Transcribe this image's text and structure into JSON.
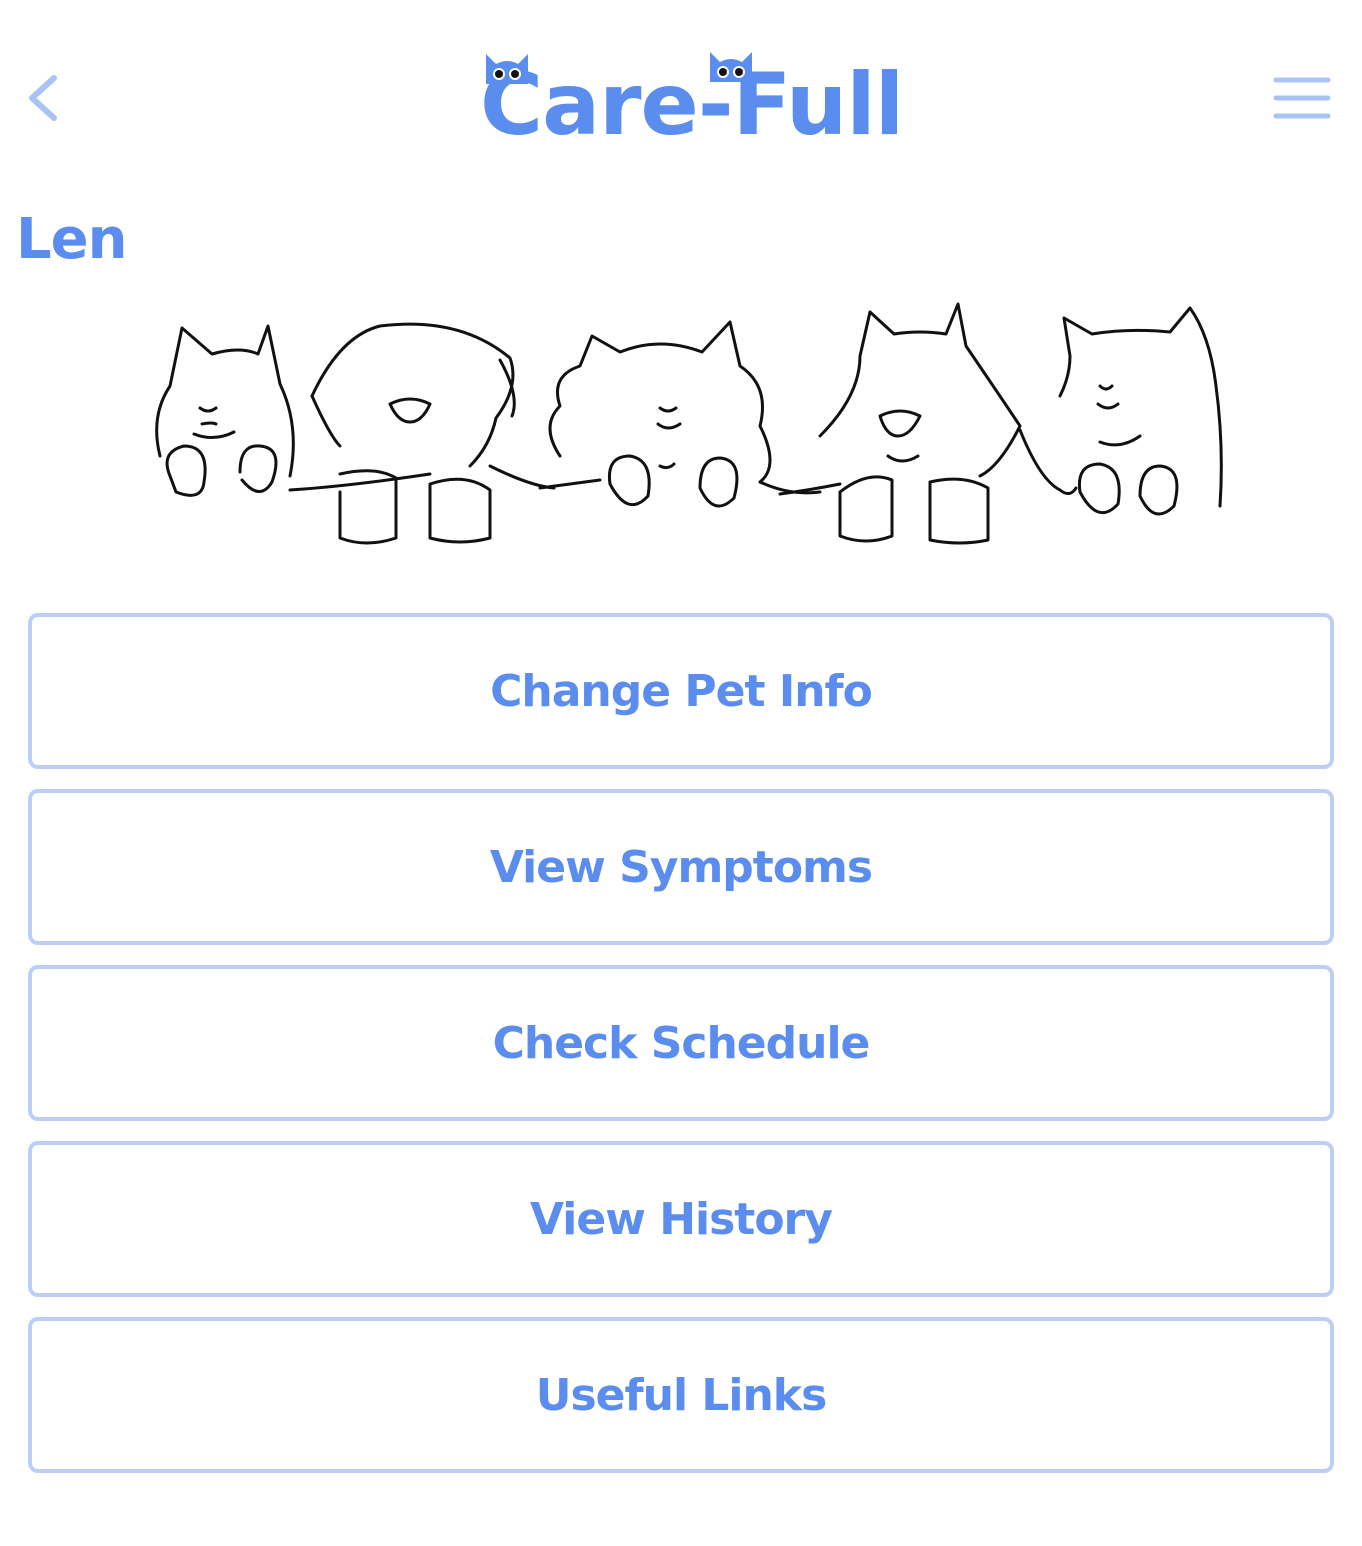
{
  "header": {
    "app_title": "Care-Full",
    "back_icon": "chevron-left-icon",
    "menu_icon": "hamburger-menu-icon"
  },
  "pet": {
    "name": "Len"
  },
  "illustration": {
    "icon": "pets-line-drawing"
  },
  "actions": [
    {
      "label": "Change Pet Info"
    },
    {
      "label": "View Symptoms"
    },
    {
      "label": "Check Schedule"
    },
    {
      "label": "View History"
    },
    {
      "label": "Useful Links"
    }
  ],
  "colors": {
    "accent": "#5b8def",
    "button_border": "#bcd0f7",
    "icon_light": "#a9c3f5"
  }
}
